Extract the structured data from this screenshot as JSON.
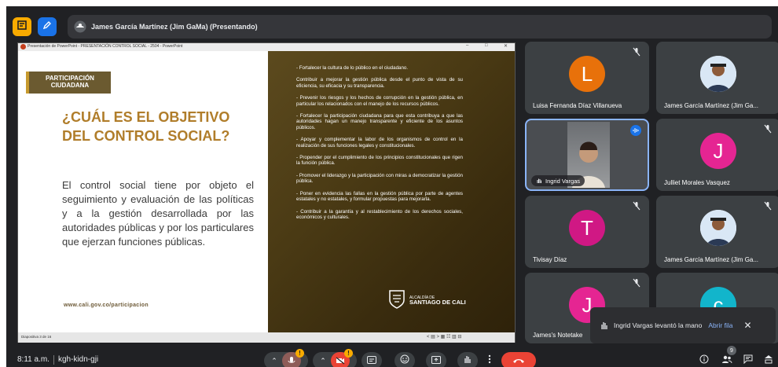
{
  "header": {
    "presenter": "James García Martínez (Jim GaMa) (Presentando)"
  },
  "presentation": {
    "window_title": "Presentación de PowerPoint - PRESENTACIÓN CONTROL SOCIAL - 2504 - PowerPoint",
    "minimize": "–",
    "restore": "□",
    "close": "✕",
    "section_label": "PARTICIPACIÓN CIUDADANA",
    "heading": "¿CUÁL ES EL OBJETIVO DEL CONTROL SOCIAL?",
    "body": "El control social tiene por objeto el seguimiento y evaluación de las políticas y a la gestión desarrollada por las autoridades públicas y por los particulares que ejerzan funciones públicas.",
    "url": "www.cali.gov.co/participacion",
    "bullets": [
      "- Fortalecer la cultura de lo público en el ciudadano.",
      "Contribuir a mejorar la gestión pública desde el punto de vista de su eficiencia, su eficacia y su transparencia.",
      "- Prevenir los riesgos y los hechos de corrupción en la gestión pública, en particular los relacionados con el manejo de los recursos públicos.",
      "- Fortalecer la participación ciudadana para que esta contribuya a que las autoridades hagan un manejo transparente y eficiente de los asuntos públicos.",
      "- Apoyar y complementar la labor de los organismos de control en la realización de sus funciones legales y constitucionales.",
      "- Propender por el cumplimiento de los principios constitucionales que rigen la función pública.",
      "- Promover el liderazgo y la participación con miras a democratizar la gestión pública.",
      "- Poner en evidencia las fallas en la gestión pública por parte de agentes estatales y no estatales, y formular propuestas para mejorarla.",
      "- Contribuir a la garantía y al restablecimiento de los derechos sociales, económicos y culturales."
    ],
    "logo_small": "ALCALDÍA DE",
    "logo_big": "SANTIAGO DE CALI",
    "status_left": "Diapositiva 3 de 16",
    "status_right": "< ▤ >    ▦  ☷  ▥  ⊟"
  },
  "participants": [
    {
      "name": "Luisa Fernanda Díaz Villanueva",
      "initial": "L",
      "color": "#e8710a"
    },
    {
      "name": "James García Martínez (Jim Ga...",
      "initial": "",
      "color": "#ffffff"
    },
    {
      "name": "Ingrid Vargas",
      "initial": "",
      "color": "#c8c8c8"
    },
    {
      "name": "Julliet Morales Vasquez",
      "initial": "J",
      "color": "#e52592"
    },
    {
      "name": "Tivisay Díaz",
      "initial": "T",
      "color": "#d01884"
    },
    {
      "name": "James García Martínez (Jim Ga...",
      "initial": "",
      "color": "#ffffff"
    },
    {
      "name": "James's Notetake",
      "initial": "J",
      "color": "#e52592"
    },
    {
      "name": "",
      "initial": "c",
      "color": "#12b5cb"
    }
  ],
  "toast": {
    "message": "Ingrid Vargas levantó la mano",
    "action": "Abrir fila"
  },
  "bottom": {
    "time": "8:11 a.m.",
    "meeting_code": "kgh-kidn-gji",
    "people_count": "9",
    "badge_mark": "!"
  },
  "colors": {
    "background": "#202124",
    "tile": "#3c4043",
    "accent_blue": "#8ab4f8",
    "hangup": "#ea4335",
    "gold": "#b07d2a"
  }
}
